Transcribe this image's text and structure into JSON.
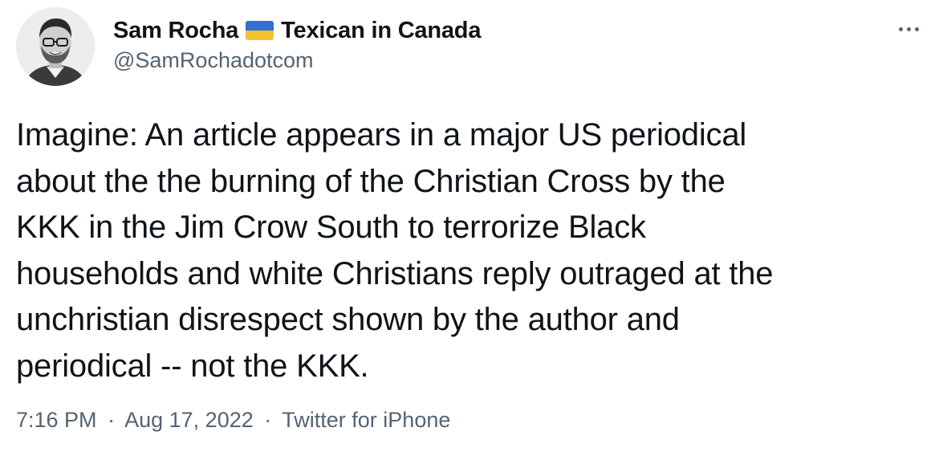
{
  "tweet": {
    "author": {
      "display_name_start": "Sam Rocha",
      "flag_icon": "ukraine-flag-icon",
      "display_name_end": "Texican in Canada",
      "handle": "@SamRochadotcom"
    },
    "menu_icon": "more-horizontal-icon",
    "text": "Imagine: An article appears in a major US periodical\nabout the the burning of the Christian Cross by the\nKKK in the Jim Crow South to terrorize Black\nhouseholds and white Christians reply outraged at the\nunchristian disrespect shown by the author and\nperiodical -- not the KKK.",
    "time": "7:16 PM",
    "separator": "·",
    "date": "Aug 17, 2022",
    "source": "Twitter for iPhone"
  },
  "colors": {
    "text_primary": "#0f1419",
    "text_secondary": "#536471",
    "flag_blue": "#2f6fd6",
    "flag_yellow": "#f3c12b"
  }
}
